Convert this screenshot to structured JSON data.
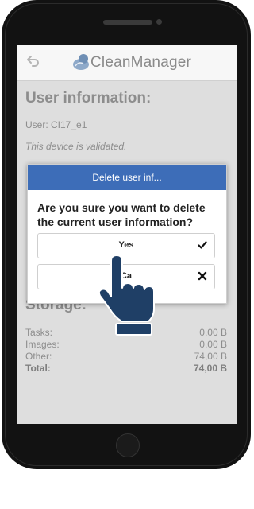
{
  "app": {
    "title": "CleanManager"
  },
  "user_section": {
    "heading": "User information:",
    "user_line": "User: CI17_e1",
    "validated_note": "This device is validated."
  },
  "dialog": {
    "title": "Delete user inf...",
    "message": "Are you sure you want to delete the current user information?",
    "yes_label": "Yes",
    "cancel_label": "Ca"
  },
  "storage": {
    "heading": "Storage:",
    "rows": [
      {
        "label": "Tasks:",
        "value": "0,00 B"
      },
      {
        "label": "Images:",
        "value": "0,00 B"
      },
      {
        "label": "Other:",
        "value": "74,00 B"
      },
      {
        "label": "Total:",
        "value": "74,00 B"
      }
    ]
  },
  "colors": {
    "dialog_header": "#3d6db8",
    "hand": "#1f3f66"
  },
  "icons": [
    "back-arrow",
    "cloud-logo",
    "checkmark",
    "cross",
    "pointing-hand"
  ]
}
